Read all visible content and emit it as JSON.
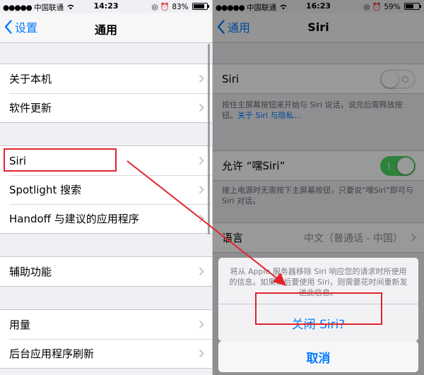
{
  "left": {
    "status": {
      "carrier": "中国联通",
      "time": "14:23",
      "battery": "83%",
      "battery_level": 0.83
    },
    "nav": {
      "back_label": "设置",
      "title": "通用"
    },
    "groups": [
      [
        "关于本机",
        "软件更新"
      ],
      [
        "Siri",
        "Spotlight 搜索",
        "Handoff 与建议的应用程序"
      ],
      [
        "辅助功能"
      ],
      [
        "用量",
        "后台应用程序刷新"
      ]
    ]
  },
  "right": {
    "status": {
      "carrier": "中国联通",
      "time": "16:23",
      "battery": "59%",
      "battery_level": 0.59
    },
    "nav": {
      "back_label": "通用",
      "title": "Siri"
    },
    "siri_row": {
      "label": "Siri",
      "enabled": false
    },
    "siri_footer": "按住主屏幕按钮来开始与 Siri 说话，说完后需释放按钮。",
    "siri_footer_link": "关于 Siri 与隐私…",
    "hey_siri_row": {
      "label": "允许 “嘿Siri”",
      "enabled": true
    },
    "hey_siri_footer": "接上电源时无需按下主屏幕按钮，只要说“嘿Siri”即可与 Siri 对话。",
    "language_row": {
      "label": "语言",
      "value": "中文（普通话 - 中国）"
    },
    "sheet": {
      "message": "将从 Apple 服务器移除 Siri 响应您的请求时所使用的信息。如果以后要使用 Siri，则需要花时间重新发送此信息。",
      "action_label": "关闭 Siri?",
      "cancel_label": "取消"
    }
  },
  "colors": {
    "accent": "#007aff",
    "highlight": "#e2242b",
    "switch_on": "#4cd964"
  }
}
